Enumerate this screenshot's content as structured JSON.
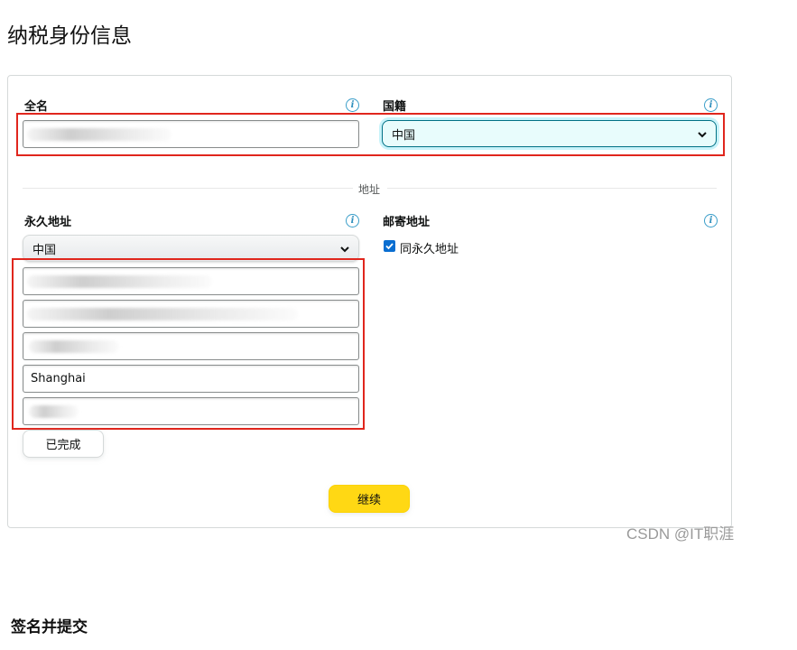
{
  "page": {
    "title": "纳税身份信息"
  },
  "tax_form": {
    "full_name": {
      "label": "全名",
      "value": ""
    },
    "nationality": {
      "label": "国籍",
      "value": "中国"
    },
    "address_divider": "地址",
    "permanent_address": {
      "label": "永久地址",
      "country": "中国",
      "city": "Shanghai"
    },
    "mailing_address": {
      "label": "邮寄地址",
      "same_as_permanent": {
        "label": "同永久地址",
        "checked": true
      }
    },
    "done_button": "已完成",
    "continue_button": "继续"
  },
  "watermark": "CSDN @IT职涯",
  "next_section": {
    "title": "签名并提交"
  },
  "colors": {
    "highlight_red": "#e0261d",
    "primary_yellow": "#ffd814",
    "info_blue": "#2f8fbd"
  }
}
